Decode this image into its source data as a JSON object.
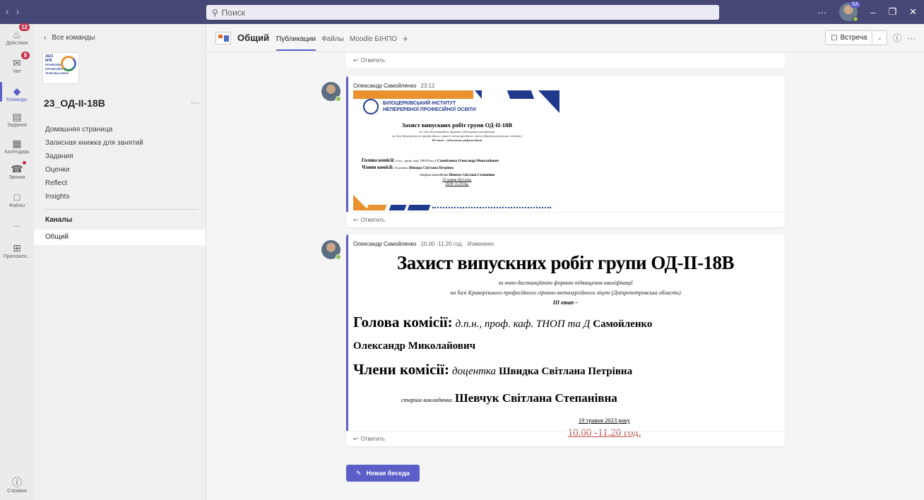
{
  "titlebar": {
    "search_placeholder": "Поиск",
    "user_badge": "SA"
  },
  "rail": {
    "items": [
      {
        "label": "Действия",
        "badge": "12"
      },
      {
        "label": "Чат",
        "badge": "8"
      },
      {
        "label": "Команды"
      },
      {
        "label": "Задания"
      },
      {
        "label": "Календарь"
      },
      {
        "label": "Звонки"
      },
      {
        "label": "Файлы"
      },
      {
        "label": "..."
      },
      {
        "label": "Приложен..."
      }
    ],
    "help_label": "Справка"
  },
  "team_panel": {
    "back_label": "Все команды",
    "team_name": "23_ОД-ІІ-18В",
    "logo_lines": [
      "2023",
      "КПК",
      "ПРОФЕСІЙНА",
      "(ПРОФЕСІЙНО",
      "ТЕХНІЧНА) ОСВІТА"
    ],
    "nav": [
      "Домашняя страница",
      "Записная книжка для занятий",
      "Задания",
      "Оценки",
      "Reflect",
      "Insights"
    ],
    "channels_header": "Каналы",
    "channels": [
      "Общий"
    ]
  },
  "header": {
    "channel_title": "Общий",
    "tabs": [
      "Публикации",
      "Файлы",
      "Moodle БІНПО"
    ],
    "meet_label": "Встреча"
  },
  "feed": {
    "reply_label": "Ответить",
    "posts": [
      {
        "author": "Олександр Самойленко",
        "time": "23:12",
        "card": {
          "institute_line1": "БІЛОЦЕРКІВСЬКИЙ ІНСТИТУТ",
          "institute_line2": "НЕПЕРЕРВНОЇ ПРОФЕСІЙНОЇ ОСВІТИ",
          "title": "Захист випускних робіт групи ОД-ІІ-18В",
          "sub1": "за очно-дистанційною формою підвищення кваліфікації",
          "sub2": "на базі Криворізького професійного гірничо-металургійного ліцею (Дніпропетровська область)",
          "stage": "ІІІ етап – підсумково-рефлексійний",
          "head_label": "Голова комісії:",
          "head_value": "д.п.н., проф. каф. ТНОП та Д",
          "head_name": "Самойленко Олександр Миколайович",
          "members_label": "Члени комісії:",
          "members_value": "доцентка",
          "members_name": "Швидка Світлана Петрівна",
          "senior_value": "старша викладачка",
          "senior_name": "Шевчук Світлана Степанівна",
          "date": "19 травня 2023 року",
          "time": "10.00 -11.20 год."
        }
      },
      {
        "author": "Олександр Самойленко",
        "time": "10.00 -11.20 год.",
        "edited": "Изменено",
        "title": "Захист випускних робіт групи ОД-ІІ-18В",
        "sub1": "за очно-дистанційною формою підвищення кваліфікації",
        "sub2": "на базі Криворізького професійного гірничо-металургійного ліцею (Дніпропетровська область)",
        "stage": "ІІІ етап –",
        "head_label": "Голова комісії:",
        "head_value": "д.п.н., проф. каф. ТНОП та Д",
        "head_name1": "Самойленко",
        "head_name2": "Олександр Миколайович",
        "members_label": "Члени комісії:",
        "members_value": "доцентка",
        "members_name": "Швидка Світлана Петрівна",
        "senior_value": "старша викладачка",
        "senior_name": "Шевчук Світлана Степанівна",
        "date": "19 травня 2023 року"
      }
    ],
    "new_conversation": "Новая беседа"
  },
  "colors": {
    "titlebar": "#464775",
    "brand": "#5b5fc7",
    "badge": "#c4314b",
    "presence": "#92c353",
    "orange": "#e8912e",
    "navy": "#1f3a8c"
  }
}
